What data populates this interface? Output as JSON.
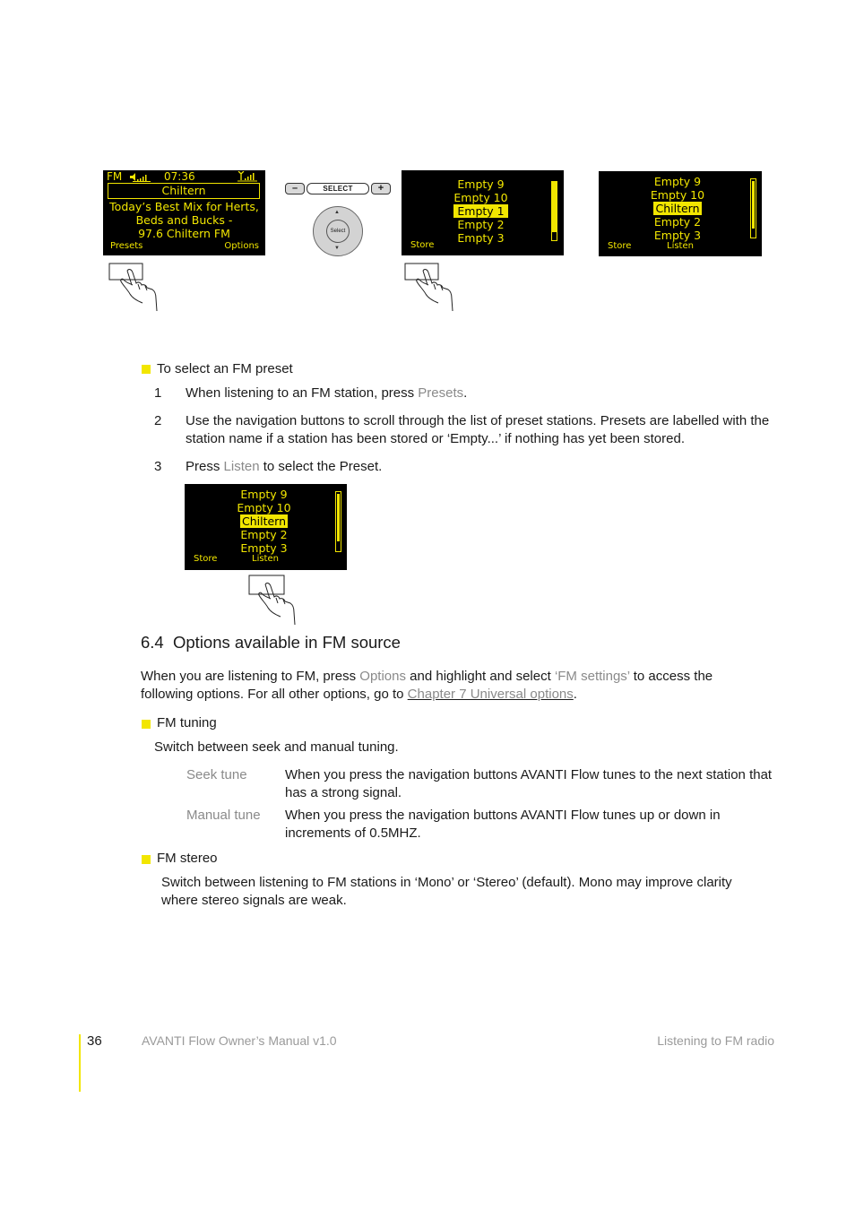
{
  "colors": {
    "lcd_background": "#000000",
    "lcd_text": "#f2e600",
    "bullet": "#f2e600",
    "footer_bar": "#f2e600",
    "ui_term": "#8a8a8a"
  },
  "figures": {
    "now_playing_screen": {
      "source": "FM",
      "time": "07:36",
      "station": "Chiltern",
      "radio_text": [
        "Today’s Best Mix for Herts,",
        "Beds and Bucks -",
        "97.6 Chiltern FM"
      ],
      "softkey_left": "Presets",
      "softkey_right": "Options",
      "icons": [
        "speaker-volume-icon",
        "signal-strength-icon"
      ]
    },
    "remote": {
      "minus_label": "–",
      "select_bar_label": "SELECT",
      "plus_label": "+",
      "dial_center_label": "Select",
      "up_arrow": "▲",
      "down_arrow": "▼"
    },
    "preset_screen_1": {
      "items": [
        "Empty 9",
        "Empty 10",
        "Empty 1",
        "Empty 2",
        "Empty 3"
      ],
      "highlighted_index": 2,
      "softkey_left": "Store",
      "softkey_right": "",
      "scroll_position": 0.85
    },
    "preset_screen_2": {
      "items": [
        "Empty 9",
        "Empty 10",
        "Chiltern",
        "Empty 2",
        "Empty 3"
      ],
      "highlighted_index": 2,
      "softkey_left": "Store",
      "softkey_right": "Listen",
      "scroll_position": 0.85
    },
    "preset_screen_3": {
      "items": [
        "Empty 9",
        "Empty 10",
        "Chiltern",
        "Empty 2",
        "Empty 3"
      ],
      "highlighted_index": 2,
      "softkey_left": "Store",
      "softkey_right": "Listen",
      "scroll_position": 0.85
    }
  },
  "preset_section": {
    "heading": "To select an FM preset",
    "steps": [
      {
        "num": "1",
        "pre": "When listening to an FM station, press ",
        "term": "Presets",
        "post": "."
      },
      {
        "num": "2",
        "text": "Use the navigation buttons to scroll through the list of preset stations. Presets are labelled with the station name if a station has been stored or ‘Empty...’ if nothing has yet been stored."
      },
      {
        "num": "3",
        "pre": "Press ",
        "term": "Listen",
        "post": " to select the Preset."
      }
    ]
  },
  "options_section": {
    "title": "6.4  Options available in FM source",
    "intro": {
      "p1": "When you are listening to FM, press ",
      "term1": "Options",
      "p2": " and highlight and select ",
      "term2": "‘FM settings’",
      "p3": " to access the following options. For all other options, go to ",
      "link": "Chapter 7 Universal options",
      "p4": "."
    },
    "fm_tuning": {
      "heading": "FM tuning",
      "desc": "Switch between seek and manual tuning.",
      "options": [
        {
          "term": "Seek tune",
          "desc": "When you press the navigation buttons AVANTI Flow tunes to the next station that has a strong signal."
        },
        {
          "term": "Manual tune",
          "desc": "When you press the navigation buttons AVANTI Flow tunes up or down in increments of 0.5MHZ."
        }
      ]
    },
    "fm_stereo": {
      "heading": "FM stereo",
      "desc": "Switch between listening to FM stations in ‘Mono’ or ‘Stereo’ (default). Mono may improve clarity where stereo signals are weak."
    }
  },
  "footer": {
    "page_number": "36",
    "manual_title": "AVANTI Flow Owner’s Manual v1.0",
    "chapter": "Listening to FM radio"
  }
}
